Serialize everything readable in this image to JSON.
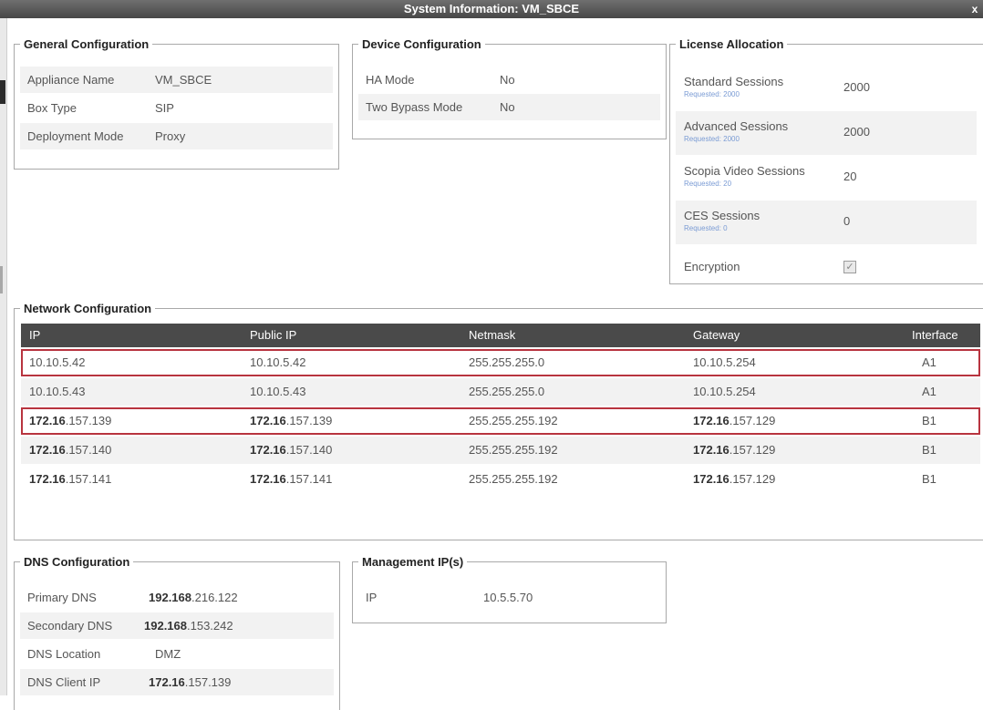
{
  "window": {
    "title": "System Information: VM_SBCE",
    "close_label": "x"
  },
  "general": {
    "legend": "General Configuration",
    "rows": [
      {
        "label": "Appliance Name",
        "value": "VM_SBCE"
      },
      {
        "label": "Box Type",
        "value": "SIP"
      },
      {
        "label": "Deployment Mode",
        "value": "Proxy"
      }
    ]
  },
  "device": {
    "legend": "Device Configuration",
    "rows": [
      {
        "label": "HA Mode",
        "value": "No"
      },
      {
        "label": "Two Bypass Mode",
        "value": "No"
      }
    ]
  },
  "license": {
    "legend": "License Allocation",
    "rows": [
      {
        "label": "Standard Sessions",
        "requested": "Requested: 2000",
        "value": "2000"
      },
      {
        "label": "Advanced Sessions",
        "requested": "Requested: 2000",
        "value": "2000"
      },
      {
        "label": "Scopia Video Sessions",
        "requested": "Requested: 20",
        "value": "20"
      },
      {
        "label": "CES Sessions",
        "requested": "Requested: 0",
        "value": "0"
      }
    ],
    "encryption_label": "Encryption",
    "encryption_checked": true
  },
  "network": {
    "legend": "Network Configuration",
    "columns": [
      "IP",
      "Public IP",
      "Netmask",
      "Gateway",
      "Interface"
    ],
    "rows": [
      {
        "ip_prefix": "",
        "ip": "10.10.5.42",
        "pub_prefix": "",
        "pub": "10.10.5.42",
        "mask": "255.255.255.0",
        "gw_prefix": "",
        "gw": "10.10.5.254",
        "iface": "A1",
        "highlighted": true
      },
      {
        "ip_prefix": "",
        "ip": "10.10.5.43",
        "pub_prefix": "",
        "pub": "10.10.5.43",
        "mask": "255.255.255.0",
        "gw_prefix": "",
        "gw": "10.10.5.254",
        "iface": "A1",
        "highlighted": false
      },
      {
        "ip_prefix": "172.16",
        "ip": ".157.139",
        "pub_prefix": "172.16",
        "pub": ".157.139",
        "mask": "255.255.255.192",
        "gw_prefix": "172.16",
        "gw": ".157.129",
        "iface": "B1",
        "highlighted": true
      },
      {
        "ip_prefix": "172.16",
        "ip": ".157.140",
        "pub_prefix": "172.16",
        "pub": ".157.140",
        "mask": "255.255.255.192",
        "gw_prefix": "172.16",
        "gw": ".157.129",
        "iface": "B1",
        "highlighted": false
      },
      {
        "ip_prefix": "172.16",
        "ip": ".157.141",
        "pub_prefix": "172.16",
        "pub": ".157.141",
        "mask": "255.255.255.192",
        "gw_prefix": "172.16",
        "gw": ".157.129",
        "iface": "B1",
        "highlighted": false
      }
    ]
  },
  "dns": {
    "legend": "DNS Configuration",
    "rows": [
      {
        "label": "Primary DNS",
        "prefix": "192.168",
        "value": ".216.122"
      },
      {
        "label": "Secondary DNS",
        "prefix": "192.168",
        "value": ".153.242"
      },
      {
        "label": "DNS Location",
        "prefix": "",
        "value": "DMZ"
      },
      {
        "label": "DNS Client IP",
        "prefix": "172.16",
        "value": ".157.139"
      }
    ]
  },
  "management": {
    "legend": "Management IP(s)",
    "rows": [
      {
        "label": "IP",
        "value": "10.5.5.70"
      }
    ]
  },
  "colors": {
    "titlebar": "#5a5a5a",
    "table_header": "#4a4a4a",
    "highlight_border": "#b8343f",
    "row_shade": "#f2f2f2"
  }
}
